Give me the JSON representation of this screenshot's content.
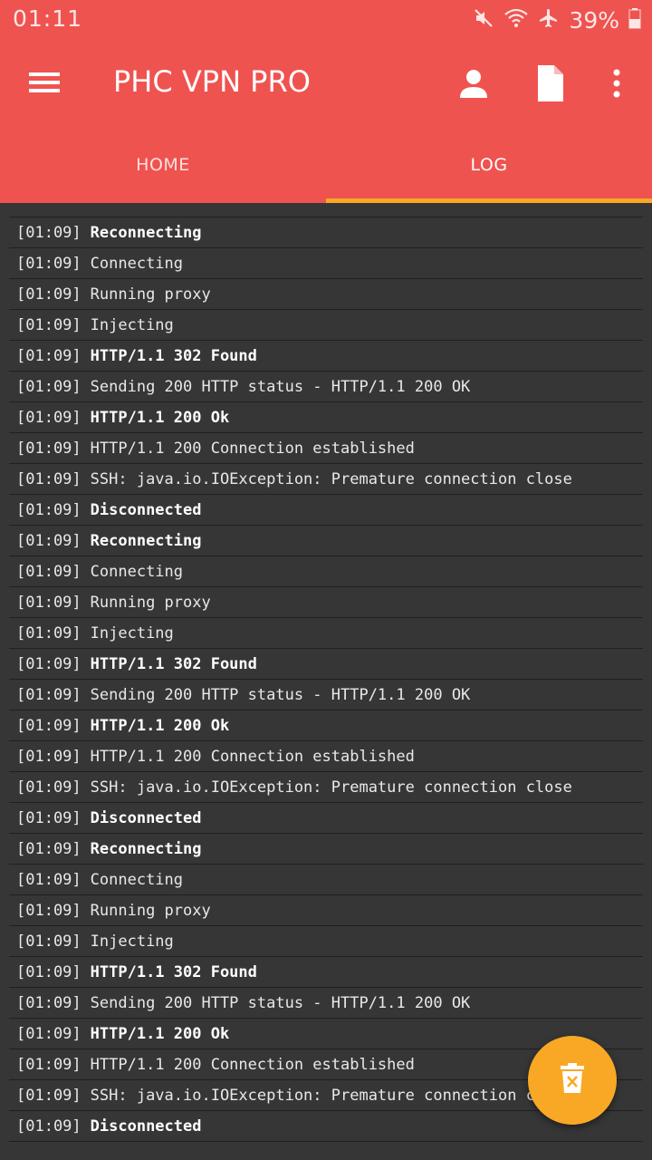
{
  "status_bar": {
    "time": "01:11",
    "battery": "39%",
    "icons": [
      "mute-icon",
      "wifi-icon",
      "airplane-icon",
      "battery-icon"
    ]
  },
  "app_bar": {
    "title": "PHC VPN PRO",
    "actions": [
      "menu-icon",
      "user-icon",
      "document-icon",
      "more-vert-icon"
    ],
    "color": "#ef5350"
  },
  "tabs": [
    {
      "label": "HOME",
      "active": false
    },
    {
      "label": "LOG",
      "active": true
    }
  ],
  "accent": "#f9a825",
  "log": [
    {
      "time": "[01:09]",
      "msg": "Reconnecting",
      "bold": true
    },
    {
      "time": "[01:09]",
      "msg": "Connecting",
      "bold": false
    },
    {
      "time": "[01:09]",
      "msg": "Running proxy",
      "bold": false
    },
    {
      "time": "[01:09]",
      "msg": "Injecting",
      "bold": false
    },
    {
      "time": "[01:09]",
      "msg": "HTTP/1.1 302 Found",
      "bold": true
    },
    {
      "time": "[01:09]",
      "msg": "Sending 200 HTTP status - HTTP/1.1 200 OK",
      "bold": false
    },
    {
      "time": "[01:09]",
      "msg": "HTTP/1.1 200 Ok",
      "bold": true
    },
    {
      "time": "[01:09]",
      "msg": "HTTP/1.1 200 Connection established",
      "bold": false
    },
    {
      "time": "[01:09]",
      "msg": "SSH: java.io.IOException: Premature connection close",
      "bold": false
    },
    {
      "time": "[01:09]",
      "msg": "Disconnected",
      "bold": true
    },
    {
      "time": "[01:09]",
      "msg": "Reconnecting",
      "bold": true
    },
    {
      "time": "[01:09]",
      "msg": "Connecting",
      "bold": false
    },
    {
      "time": "[01:09]",
      "msg": "Running proxy",
      "bold": false
    },
    {
      "time": "[01:09]",
      "msg": "Injecting",
      "bold": false
    },
    {
      "time": "[01:09]",
      "msg": "HTTP/1.1 302 Found",
      "bold": true
    },
    {
      "time": "[01:09]",
      "msg": "Sending 200 HTTP status - HTTP/1.1 200 OK",
      "bold": false
    },
    {
      "time": "[01:09]",
      "msg": "HTTP/1.1 200 Ok",
      "bold": true
    },
    {
      "time": "[01:09]",
      "msg": "HTTP/1.1 200 Connection established",
      "bold": false
    },
    {
      "time": "[01:09]",
      "msg": "SSH: java.io.IOException: Premature connection close",
      "bold": false
    },
    {
      "time": "[01:09]",
      "msg": "Disconnected",
      "bold": true
    },
    {
      "time": "[01:09]",
      "msg": "Reconnecting",
      "bold": true
    },
    {
      "time": "[01:09]",
      "msg": "Connecting",
      "bold": false
    },
    {
      "time": "[01:09]",
      "msg": "Running proxy",
      "bold": false
    },
    {
      "time": "[01:09]",
      "msg": "Injecting",
      "bold": false
    },
    {
      "time": "[01:09]",
      "msg": "HTTP/1.1 302 Found",
      "bold": true
    },
    {
      "time": "[01:09]",
      "msg": "Sending 200 HTTP status - HTTP/1.1 200 OK",
      "bold": false
    },
    {
      "time": "[01:09]",
      "msg": "HTTP/1.1 200 Ok",
      "bold": true
    },
    {
      "time": "[01:09]",
      "msg": "HTTP/1.1 200 Connection established",
      "bold": false
    },
    {
      "time": "[01:09]",
      "msg": "SSH: java.io.IOException: Premature connection close",
      "bold": false
    },
    {
      "time": "[01:09]",
      "msg": "Disconnected",
      "bold": true
    }
  ],
  "fab": {
    "icon": "clear-log-icon"
  }
}
